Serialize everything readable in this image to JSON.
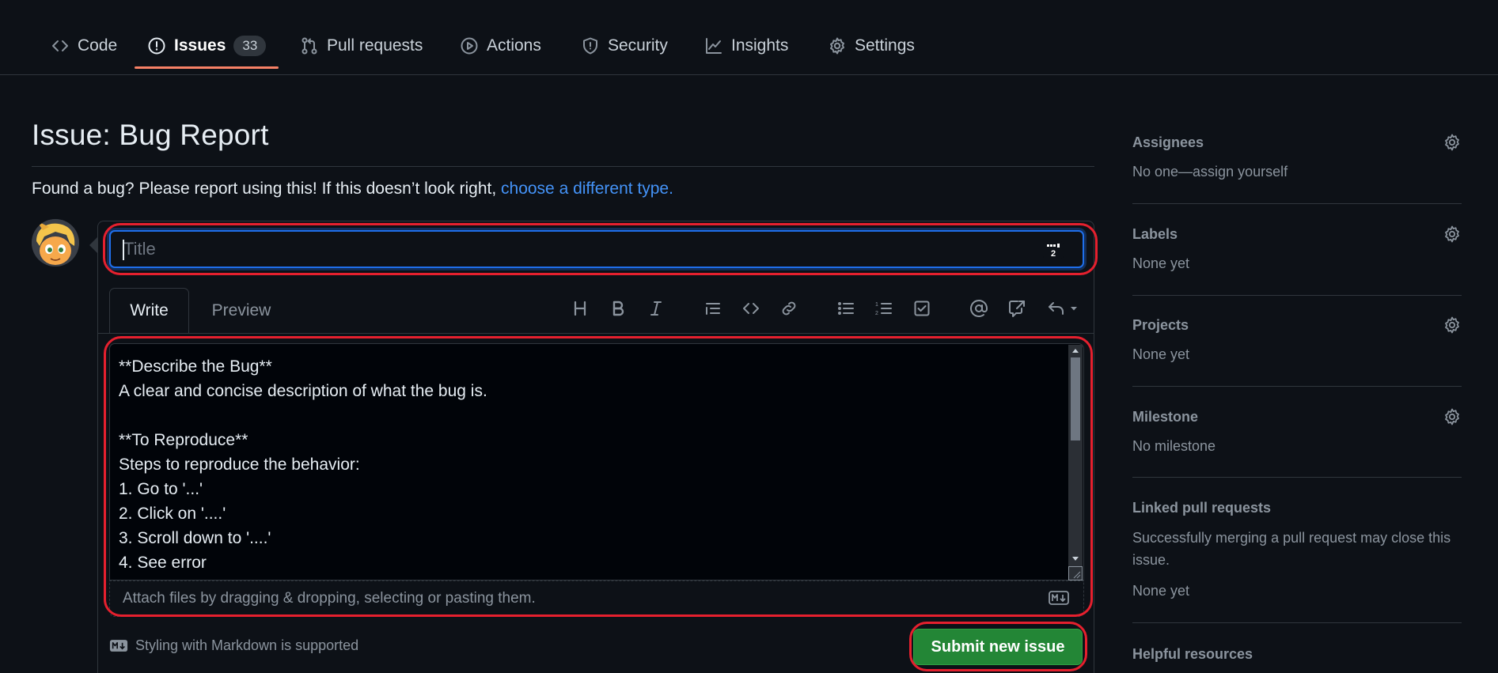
{
  "nav": {
    "tabs": [
      {
        "label": "Code",
        "icon": "code-icon"
      },
      {
        "label": "Issues",
        "icon": "issue-opened-icon",
        "count": "33",
        "active": true
      },
      {
        "label": "Pull requests",
        "icon": "git-pull-request-icon"
      },
      {
        "label": "Actions",
        "icon": "play-icon"
      },
      {
        "label": "Security",
        "icon": "shield-icon"
      },
      {
        "label": "Insights",
        "icon": "graph-icon"
      },
      {
        "label": "Settings",
        "icon": "gear-icon"
      }
    ]
  },
  "page": {
    "title": "Issue: Bug Report",
    "intro": "Found a bug? Please report using this! If this doesn’t look right, ",
    "intro_link": "choose a different type."
  },
  "form": {
    "title_placeholder": "Title",
    "title_value": "",
    "tabs": {
      "write": "Write",
      "preview": "Preview"
    },
    "body": "**Describe the Bug**\nA clear and concise description of what the bug is.\n\n**To Reproduce**\nSteps to reproduce the behavior:\n1. Go to '...'\n2. Click on '....'\n3. Scroll down to '....'\n4. See error",
    "attach_hint": "Attach files by dragging & dropping, selecting or pasting them.",
    "markdown_note": "Styling with Markdown is supported",
    "submit_label": "Submit new issue",
    "toolbar": [
      "heading-icon",
      "bold-icon",
      "italic-icon",
      "quote-icon",
      "code-icon",
      "link-icon",
      "bulleted-list-icon",
      "numbered-list-icon",
      "task-list-icon",
      "mention-icon",
      "cross-reference-icon",
      "reply-icon"
    ]
  },
  "sidebar": {
    "assignees": {
      "title": "Assignees",
      "value": "No one—assign yourself"
    },
    "labels": {
      "title": "Labels",
      "value": "None yet"
    },
    "projects": {
      "title": "Projects",
      "value": "None yet"
    },
    "milestone": {
      "title": "Milestone",
      "value": "No milestone"
    },
    "linked_prs": {
      "title": "Linked pull requests",
      "description": "Successfully merging a pull request may close this issue.",
      "value": "None yet"
    },
    "helpful": {
      "title": "Helpful resources"
    }
  },
  "colors": {
    "background": "#0d1117",
    "accent_underline": "#f78166",
    "link": "#4493f8",
    "submit": "#238636",
    "annotation": "#e5202e"
  }
}
